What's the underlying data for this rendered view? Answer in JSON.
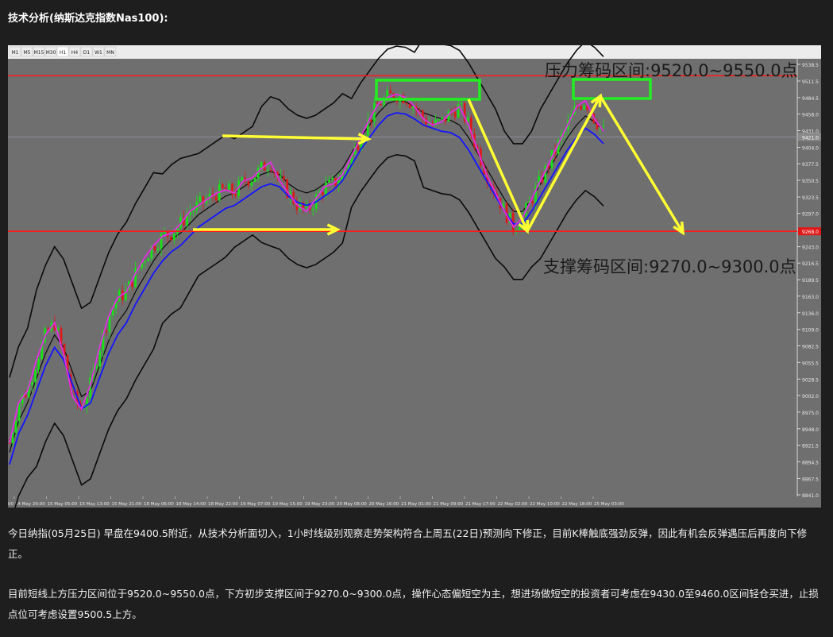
{
  "heading": "技术分析(纳斯达克指数Nas100):",
  "toolbar": {
    "timeframes": [
      "M1",
      "M5",
      "M15",
      "M30",
      "H1",
      "H4",
      "D1",
      "W1",
      "MN"
    ]
  },
  "chart_data": {
    "type": "line",
    "price_axis_ticks": [
      "9538.5",
      "9511.5",
      "9484.5",
      "9458.0",
      "9431.0",
      "9404.0",
      "9377.5",
      "9350.5",
      "9323.5",
      "9297.0",
      "9270.0",
      "9243.0",
      "9216.5",
      "9189.5",
      "9163.0",
      "9136.0",
      "9109.0",
      "9082.5",
      "9055.5",
      "9028.5",
      "9002.0",
      "8975.0",
      "8948.0",
      "8921.5",
      "8894.5",
      "8867.5",
      "8841.0"
    ],
    "time_axis_ticks": [
      "14 May 20:00",
      "15 May 05:00",
      "15 May 13:00",
      "15 May 21:00",
      "18 May 06:00",
      "18 May 14:00",
      "18 May 22:00",
      "19 May 07:00",
      "19 May 15:00",
      "19 May 23:00",
      "20 May 08:00",
      "20 May 16:00",
      "21 May 01:00",
      "21 May 09:00",
      "21 May 17:00",
      "22 May 02:00",
      "22 May 10:00",
      "22 May 18:00",
      "25 May 03:00"
    ],
    "time_axis_prefix": "00",
    "ylim": [
      8841.0,
      9538.5
    ],
    "current_price_label": "9421.0",
    "red_level_label": "9268.0",
    "horizontal_levels": [
      9520.0,
      9268.0
    ],
    "annotations": {
      "resistance": "压力筹码区间:9520.0~9550.0点",
      "support": "支撑筹码区间:9270.0~9300.0点"
    },
    "series": [
      {
        "values": [
          8925,
          8990,
          9010,
          9060,
          9100,
          9120,
          9070,
          9000,
          8980,
          9020,
          9080,
          9130,
          9160,
          9170,
          9200,
          9225,
          9245,
          9260,
          9265,
          9280,
          9300,
          9310,
          9320,
          9330,
          9335,
          9330,
          9350,
          9355,
          9370,
          9380,
          9350,
          9330,
          9310,
          9300,
          9320,
          9340,
          9345,
          9360,
          9390,
          9420,
          9450,
          9475,
          9485,
          9490,
          9485,
          9470,
          9450,
          9440,
          9445,
          9460,
          9470,
          9440,
          9400,
          9360,
          9330,
          9300,
          9275,
          9290,
          9320,
          9350,
          9380,
          9410,
          9440,
          9470,
          9480,
          9450,
          9430
        ]
      },
      {
        "values": [
          8910,
          8960,
          8990,
          9030,
          9070,
          9100,
          9080,
          9040,
          9000,
          9010,
          9050,
          9090,
          9120,
          9140,
          9170,
          9195,
          9220,
          9240,
          9255,
          9265,
          9280,
          9295,
          9305,
          9315,
          9325,
          9330,
          9340,
          9350,
          9360,
          9365,
          9360,
          9345,
          9335,
          9330,
          9335,
          9345,
          9355,
          9370,
          9395,
          9420,
          9440,
          9460,
          9475,
          9480,
          9478,
          9470,
          9460,
          9455,
          9450,
          9448,
          9440,
          9420,
          9395,
          9370,
          9345,
          9320,
          9300,
          9300,
          9320,
          9345,
          9370,
          9395,
          9420,
          9440,
          9455,
          9445,
          9430
        ]
      }
    ]
  },
  "paragraph1": "今日纳指(05月25日) 早盘在9400.5附近，从技术分析面切入，1小时线级别观察走势架构符合上周五(22日)预测向下修正，目前K棒触底强劲反弹，因此有机会反弹遇压后再度向下修正。",
  "paragraph2": "目前短线上方压力区间位于9520.0~9550.0点，下方初步支撑区间于9270.0~9300.0点，操作心态偏短空为主，想进场做短空的投资者可考虑在9430.0至9460.0区间轻仓买进，止损点位可考虑设置9500.5上方。"
}
